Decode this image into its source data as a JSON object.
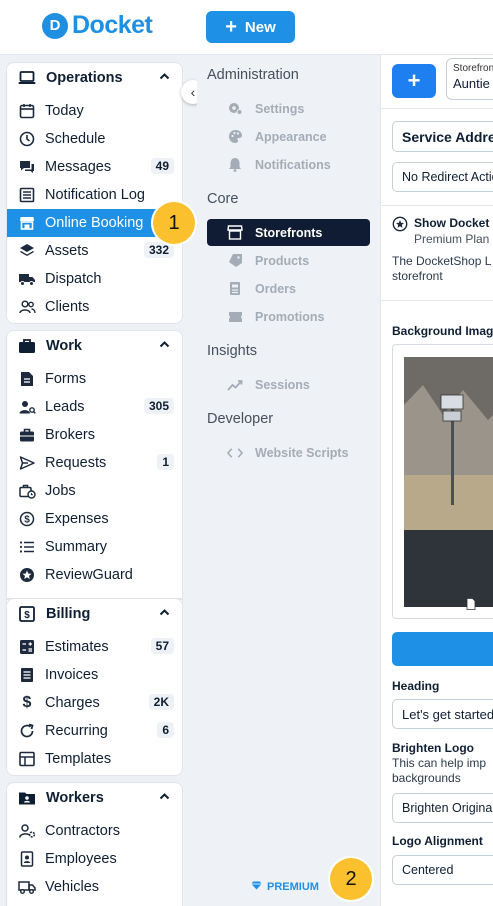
{
  "topbar": {
    "brand": "Docket",
    "brand_mark": "D",
    "new_button": "New"
  },
  "sidebar": {
    "collapse_icon": "‹",
    "sections": {
      "operations": {
        "title": "Operations",
        "items": [
          {
            "label": "Today",
            "badge": ""
          },
          {
            "label": "Schedule",
            "badge": ""
          },
          {
            "label": "Messages",
            "badge": "49"
          },
          {
            "label": "Notification Log",
            "badge": ""
          },
          {
            "label": "Online Booking",
            "badge": ""
          },
          {
            "label": "Assets",
            "badge": "332"
          },
          {
            "label": "Dispatch",
            "badge": ""
          },
          {
            "label": "Clients",
            "badge": ""
          }
        ]
      },
      "work": {
        "title": "Work",
        "items": [
          {
            "label": "Forms",
            "badge": ""
          },
          {
            "label": "Leads",
            "badge": "305"
          },
          {
            "label": "Brokers",
            "badge": ""
          },
          {
            "label": "Requests",
            "badge": "1"
          },
          {
            "label": "Jobs",
            "badge": ""
          },
          {
            "label": "Expenses",
            "badge": ""
          },
          {
            "label": "Summary",
            "badge": ""
          },
          {
            "label": "ReviewGuard",
            "badge": ""
          }
        ]
      },
      "billing": {
        "title": "Billing",
        "items": [
          {
            "label": "Estimates",
            "badge": "57"
          },
          {
            "label": "Invoices",
            "badge": ""
          },
          {
            "label": "Charges",
            "badge": "2K"
          },
          {
            "label": "Recurring",
            "badge": "6"
          },
          {
            "label": "Templates",
            "badge": ""
          }
        ]
      },
      "workers": {
        "title": "Workers",
        "items": [
          {
            "label": "Contractors",
            "badge": ""
          },
          {
            "label": "Employees",
            "badge": ""
          },
          {
            "label": "Vehicles",
            "badge": ""
          }
        ]
      }
    }
  },
  "markers": {
    "one": "1",
    "two": "2"
  },
  "settings_nav": {
    "administration": {
      "title": "Administration",
      "items": [
        "Settings",
        "Appearance",
        "Notifications"
      ]
    },
    "core": {
      "title": "Core",
      "items": [
        "Storefronts",
        "Products",
        "Orders",
        "Promotions"
      ]
    },
    "insights": {
      "title": "Insights",
      "items": [
        "Sessions"
      ]
    },
    "developer": {
      "title": "Developer",
      "items": [
        "Website Scripts"
      ]
    },
    "premium": "PREMIUM"
  },
  "main": {
    "plus_label": "+",
    "storefront_label": "Storefront",
    "storefront_value": "Auntie",
    "service_address": "Service Address",
    "redirect_value": "No Redirect Action",
    "show_docket_title": "Show Docket",
    "show_docket_sub": "Premium Plan",
    "docketshop_text_1": "The DocketShop L",
    "docketshop_text_2": "storefront",
    "background_image_label": "Background Image",
    "heading_label": "Heading",
    "heading_value": "Let's get started",
    "brighten_logo_label": "Brighten Logo",
    "brighten_help_1": "This can help imp",
    "brighten_help_2": "backgrounds",
    "brighten_value": "Brighten Original",
    "logo_alignment_label": "Logo Alignment",
    "logo_alignment_value": "Centered"
  },
  "colors": {
    "accent": "#1e90e6",
    "active_dark": "#0f1c33",
    "marker": "#fbc02d"
  }
}
